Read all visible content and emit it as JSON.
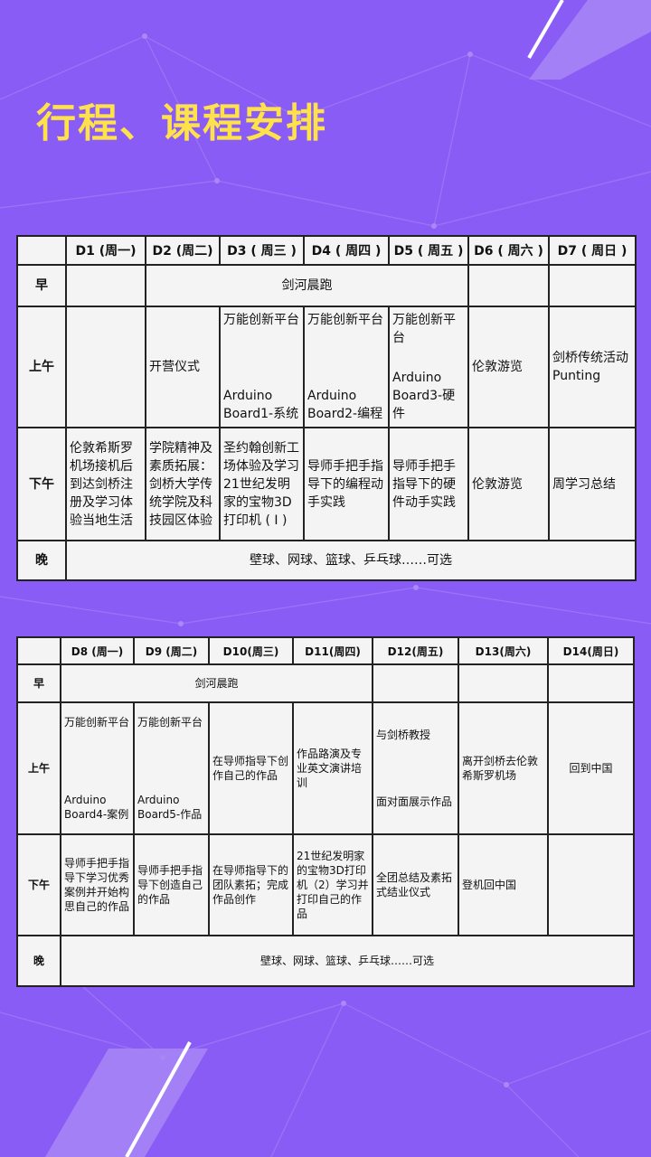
{
  "title": "行程、课程安排",
  "table1": {
    "headers": [
      "",
      "D1 (周一)",
      "D2 (周二)",
      "D3 ( 周三 )",
      "D4 ( 周四 )",
      "D5 ( 周五 )",
      "D6 ( 周六 )",
      "D7 ( 周日 )"
    ],
    "row_labels": {
      "morning": "早",
      "am": "上午",
      "pm": "下午",
      "evening": "晚"
    },
    "morning": {
      "d2_d5": "剑河晨跑"
    },
    "am": {
      "d1": "",
      "d2": "开营仪式",
      "d3_top": "万能创新平台",
      "d3_bottom": "Arduino Board1-系统",
      "d4_top": "万能创新平台",
      "d4_bottom": "Arduino Board2-编程",
      "d5_top": "万能创新平台",
      "d5_bottom": "Arduino Board3-硬件",
      "d6": "伦敦游览",
      "d7": "剑桥传统活动Punting"
    },
    "pm": {
      "d1": "伦敦希斯罗机场接机后到达剑桥注册及学习体验当地生活",
      "d2": "学院精神及素质拓展：剑桥大学传统学院及科技园区体验",
      "d3": "圣约翰创新工场体验及学习21世纪发明家的宝物3D打印机 ( I )",
      "d4": "导师手把手指导下的编程动手实践",
      "d5": "导师手把手指导下的硬件动手实践",
      "d6": "伦敦游览",
      "d7": "周学习总结"
    },
    "evening": "壁球、网球、篮球、乒乓球……可选"
  },
  "table2": {
    "headers": [
      "",
      "D8 (周一)",
      "D9 (周二)",
      "D10(周三)",
      "D11(周四)",
      "D12(周五)",
      "D13(周六)",
      "D14(周日)"
    ],
    "row_labels": {
      "morning": "早",
      "am": "上午",
      "pm": "下午",
      "evening": "晚"
    },
    "morning": {
      "d8_d11": "剑河晨跑"
    },
    "am": {
      "d8_top": "万能创新平台",
      "d8_bottom": "Arduino Board4-案例",
      "d9_top": "万能创新平台",
      "d9_bottom": "Arduino Board5-作品",
      "d10": "在导师指导下创作自己的作品",
      "d11": "作品路演及专业英文演讲培训",
      "d12_top": "与剑桥教授",
      "d12_bottom": "面对面展示作品",
      "d13": "离开剑桥去伦敦希斯罗机场",
      "d14": "回到中国"
    },
    "pm": {
      "d8": "导师手把手指导下学习优秀案例并开始构思自己的作品",
      "d9": "导师手把手指导下创造自己的作品",
      "d10": "在导师指导下的团队素拓；完成作品创作",
      "d11": "21世纪发明家的宝物3D打印机（2）学习并打印自己的作品",
      "d12": "全团总结及素拓式结业仪式",
      "d13": "登机回中国",
      "d14": ""
    },
    "evening": "壁球、网球、篮球、乒乓球……可选"
  }
}
